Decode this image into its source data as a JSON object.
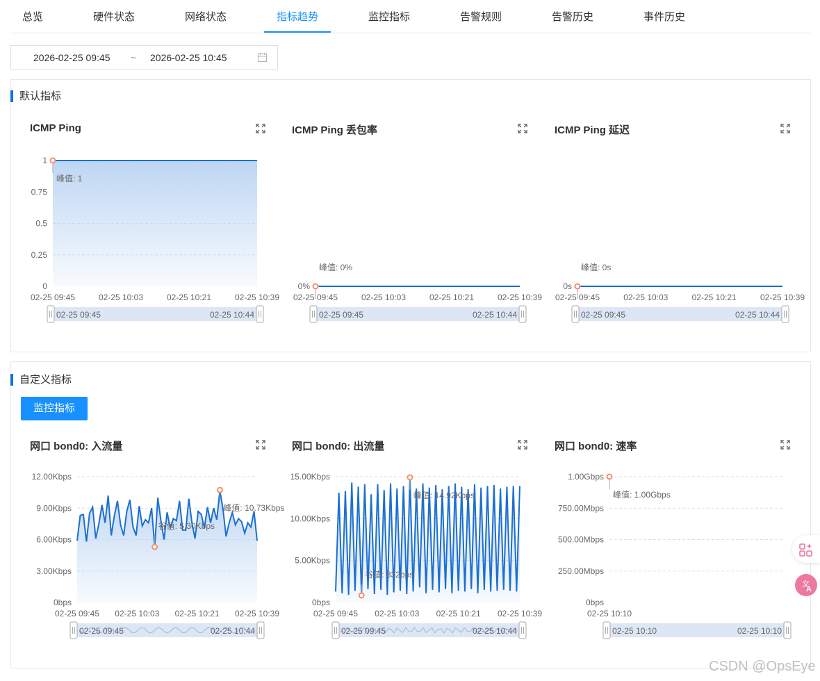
{
  "tabs": [
    {
      "label": "总览",
      "active": false
    },
    {
      "label": "硬件状态",
      "active": false
    },
    {
      "label": "网络状态",
      "active": false
    },
    {
      "label": "指标趋势",
      "active": true
    },
    {
      "label": "监控指标",
      "active": false
    },
    {
      "label": "告警规则",
      "active": false
    },
    {
      "label": "告警历史",
      "active": false
    },
    {
      "label": "事件历史",
      "active": false
    }
  ],
  "date_range": {
    "start": "2026-02-25 09:45",
    "separator": "~",
    "end": "2026-02-25 10:45",
    "icon": "calendar-icon"
  },
  "default_section": {
    "title": "默认指标"
  },
  "custom_section": {
    "title": "自定义指标",
    "button_label": "监控指标"
  },
  "watermark": "CSDN @OpsEye",
  "colors": {
    "accent": "#1890ff",
    "line": "#1c6fd1",
    "marker": "#f0906c",
    "fill_top": "#b7d2f2"
  },
  "chart_data": [
    {
      "id": "icmp-ping",
      "title": "ICMP Ping",
      "type": "area",
      "y_ticks": [
        "1",
        "0.75",
        "0.5",
        "0.25",
        "0"
      ],
      "ylim": [
        0,
        1
      ],
      "x_ticks": [
        "02-25 09:45",
        "02-25 10:03",
        "02-25 10:21",
        "02-25 10:39"
      ],
      "series": [
        {
          "values": [
            1,
            1
          ]
        }
      ],
      "markers": [
        {
          "type": "peak",
          "label": "峰值: 1",
          "index": 0,
          "value": 1
        }
      ],
      "zoom": {
        "start": "02-25 09:45",
        "end": "02-25 10:44"
      },
      "grid": true
    },
    {
      "id": "icmp-loss",
      "title": "ICMP Ping 丢包率",
      "type": "line",
      "y_ticks": [
        "0%"
      ],
      "ylim": [
        0,
        1
      ],
      "x_ticks": [
        "02-25 09:45",
        "02-25 10:03",
        "02-25 10:21",
        "02-25 10:39"
      ],
      "series": [
        {
          "values": [
            0,
            0
          ]
        }
      ],
      "markers": [
        {
          "type": "peak",
          "label": "峰值: 0%",
          "index": 0,
          "value": 0
        }
      ],
      "zoom": {
        "start": "02-25 09:45",
        "end": "02-25 10:44"
      },
      "grid": false
    },
    {
      "id": "icmp-latency",
      "title": "ICMP Ping 延迟",
      "type": "line",
      "y_ticks": [
        "0s"
      ],
      "ylim": [
        0,
        1
      ],
      "x_ticks": [
        "02-25 09:45",
        "02-25 10:03",
        "02-25 10:21",
        "02-25 10:39"
      ],
      "series": [
        {
          "values": [
            0,
            0
          ]
        }
      ],
      "markers": [
        {
          "type": "peak",
          "label": "峰值: 0s",
          "index": 0,
          "value": 0
        }
      ],
      "zoom": {
        "start": "02-25 09:45",
        "end": "02-25 10:44"
      },
      "grid": false
    },
    {
      "id": "bond0-in",
      "title": "网口 bond0: 入流量",
      "type": "area",
      "y_ticks": [
        "12.00Kbps",
        "9.00Kbps",
        "6.00Kbps",
        "3.00Kbps",
        "0bps"
      ],
      "ylim": [
        0,
        12
      ],
      "x_ticks": [
        "02-25 09:45",
        "02-25 10:03",
        "02-25 10:21",
        "02-25 10:39"
      ],
      "series": [
        {
          "values": [
            5.9,
            8.3,
            8.4,
            5.8,
            8.5,
            9.1,
            6.1,
            7.5,
            9.3,
            7.6,
            10.2,
            6.4,
            8.3,
            9.7,
            7.4,
            6.4,
            8.7,
            9.8,
            7.2,
            6.4,
            9.2,
            7.3,
            7.9,
            7.6,
            9.0,
            5.3,
            10.0,
            7.8,
            6.0,
            8.6,
            7.1,
            8.0,
            7.8,
            9.7,
            6.9,
            6.9,
            9.9,
            7.6,
            6.1,
            8.7,
            8.4,
            7.1,
            9.1,
            7.6,
            9.0,
            7.9,
            10.7,
            8.9,
            6.3,
            7.6,
            8.6,
            7.4,
            8.0,
            7.7,
            6.6,
            7.6,
            7.2,
            8.7,
            5.9
          ]
        }
      ],
      "markers": [
        {
          "type": "peak",
          "label": "峰值: 10.73Kbps",
          "index": 46,
          "value": 10.73
        },
        {
          "type": "valley",
          "label": "谷值: 5.30Kbps",
          "index": 25,
          "value": 5.3
        }
      ],
      "zoom": {
        "start": "02-25 09:45",
        "end": "02-25 10:44"
      },
      "grid": true
    },
    {
      "id": "bond0-out",
      "title": "网口 bond0: 出流量",
      "type": "area",
      "y_ticks": [
        "15.00Kbps",
        "10.00Kbps",
        "5.00Kbps",
        "0bps"
      ],
      "ylim": [
        0,
        15
      ],
      "x_ticks": [
        "02-25 09:45",
        "02-25 10:03",
        "02-25 10:21",
        "02-25 10:39"
      ],
      "series": [
        {
          "values": [
            1.3,
            13.1,
            1.1,
            13.3,
            0.9,
            14.3,
            1.4,
            13.8,
            1.0,
            14.1,
            1.6,
            12.9,
            1.0,
            14.1,
            1.5,
            13.4,
            0.9,
            14.2,
            1.2,
            13.6,
            1.4,
            13.9,
            1.0,
            14.9,
            1.3,
            13.6,
            1.8,
            14.2,
            1.1,
            13.7,
            1.5,
            14.0,
            1.2,
            13.5,
            1.6,
            13.9,
            1.1,
            14.2,
            1.4,
            13.8,
            1.3,
            13.5,
            1.6,
            14.1,
            1.1,
            13.7,
            1.5,
            13.9,
            1.3,
            14.0,
            1.4,
            13.6,
            1.5,
            13.8,
            1.4,
            13.9,
            1.3,
            13.9
          ]
        }
      ],
      "markers": [
        {
          "type": "peak",
          "label": "峰值: 14.92Kbps",
          "index": 23,
          "value": 14.92
        },
        {
          "type": "valley",
          "label": "谷值: 832bps",
          "index": 8,
          "value": 0.832
        }
      ],
      "zoom": {
        "start": "02-25 09:45",
        "end": "02-25 10:44"
      },
      "grid": true
    },
    {
      "id": "bond0-rate",
      "title": "网口 bond0: 速率",
      "type": "line",
      "y_ticks": [
        "1.00Gbps",
        "750.00Mbps",
        "500.00Mbps",
        "250.00Mbps",
        "0bps"
      ],
      "ylim": [
        0,
        1000
      ],
      "x_ticks": [
        "02-25 10:10"
      ],
      "series": [
        {
          "values": [
            1000
          ]
        }
      ],
      "markers": [
        {
          "type": "peak",
          "label": "峰值: 1.00Gbps",
          "index": 0,
          "value": 1000
        }
      ],
      "zoom": {
        "start": "02-25 10:10",
        "end": "02-25 10:10"
      },
      "grid": true
    }
  ]
}
